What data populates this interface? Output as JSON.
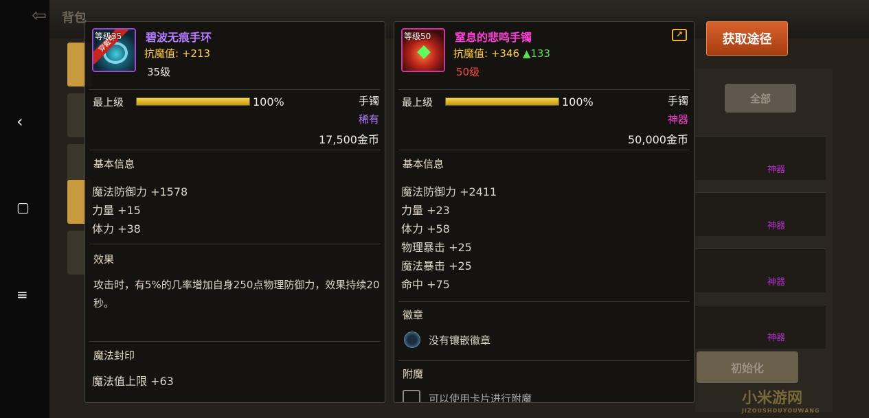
{
  "background": {
    "title": "背包",
    "all_button": "全部",
    "init_button": "初始化",
    "rarity_tags": [
      "神器",
      "神器",
      "神器",
      "神器"
    ]
  },
  "watermark": {
    "text": "小米游网",
    "sub": "JIZOUSHOUYOUWANG"
  },
  "nav": {
    "back_icon": "chevron-left",
    "home_icon": "square",
    "menu_icon": "hamburger"
  },
  "equipped_item": {
    "level_tag": "等级35",
    "equipped_badge": "穿戴中",
    "name": "碧波无痕手环",
    "stat_label": "抗魔值:",
    "stat_value": "+213",
    "req_level": "35级",
    "max_level_label": "最上级",
    "progress_percent": 100,
    "progress_text": "100%",
    "type": "手镯",
    "rarity": "稀有",
    "price": "17,500金币",
    "basic_info_header": "基本信息",
    "basic_stats": [
      "魔法防御力 +1578",
      "力量 +15",
      "体力 +38"
    ],
    "effect_header": "效果",
    "effect_text": "攻击时，有5%的几率增加自身250点物理防御力，效果持续20秒。",
    "seal_header": "魔法封印",
    "seal_stats": [
      "魔法值上限 +63"
    ]
  },
  "compared_item": {
    "level_tag": "等级50",
    "name": "窒息的悲鸣手镯",
    "stat_label": "抗魔值:",
    "stat_value": "+346",
    "stat_delta": "▲133",
    "req_level": "50级",
    "max_level_label": "最上级",
    "progress_percent": 100,
    "progress_text": "100%",
    "type": "手镯",
    "rarity": "神器",
    "price": "50,000金币",
    "basic_info_header": "基本信息",
    "basic_stats": [
      "魔法防御力 +2411",
      "力量 +23",
      "体力 +58",
      "物理暴击 +25",
      "魔法暴击 +25",
      "命中 +75"
    ],
    "emblem_header": "徽章",
    "emblem_text": "没有镶嵌徽章",
    "enchant_header": "附魔",
    "enchant_text": "可以使用卡片进行附魔"
  },
  "acquire_button": "获取途径",
  "colors": {
    "rare": "#b47cff",
    "epic": "#ff3fd6",
    "stat_gold": "#ffcc33",
    "stat_up_green": "#5bde4a",
    "level_red": "#ff4a4a",
    "button_orange": "#c8501e"
  }
}
